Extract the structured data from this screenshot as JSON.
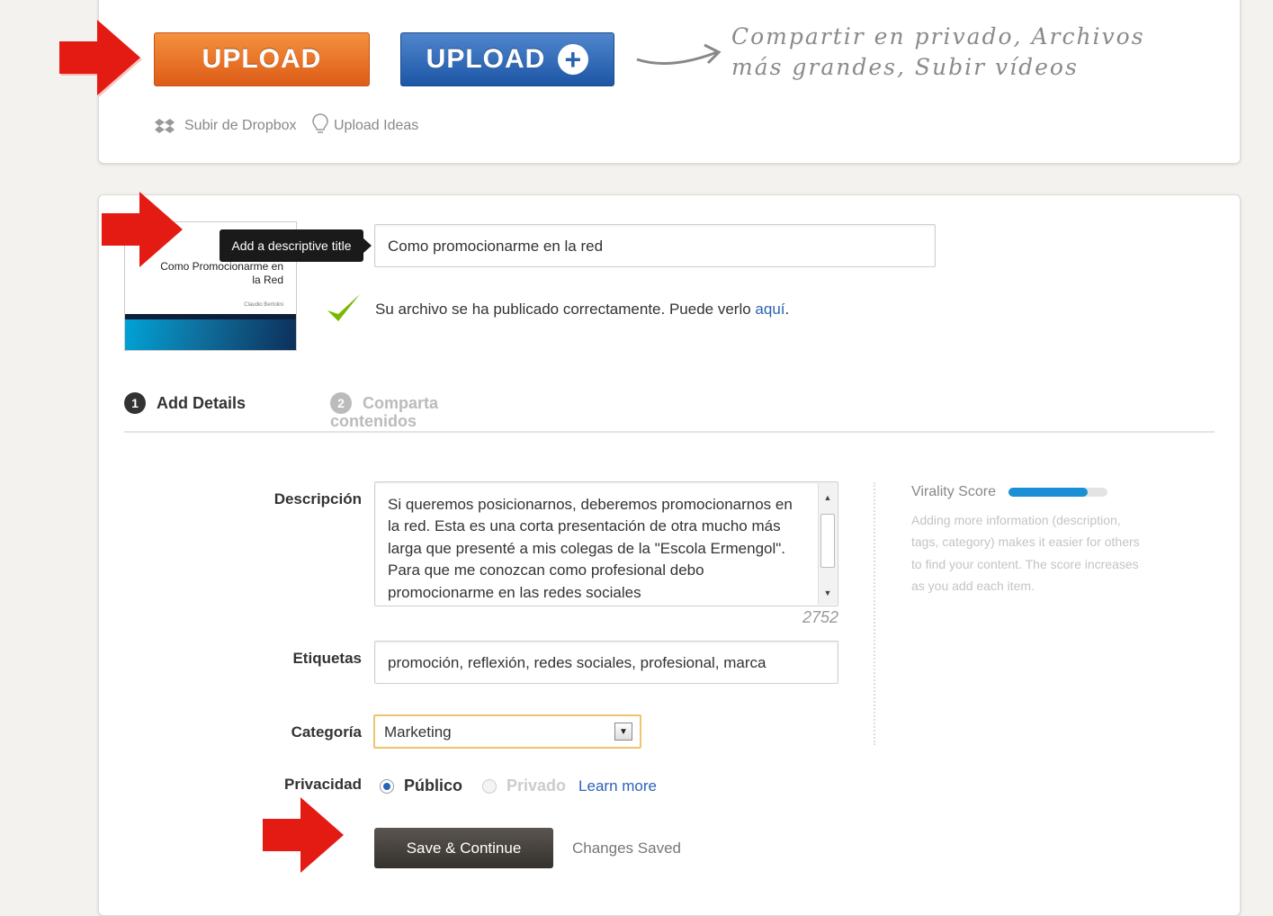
{
  "upload_bar": {
    "upload_label": "UPLOAD",
    "upload_plus_label": "UPLOAD",
    "promo_line1": "Compartir en privado, Archivos",
    "promo_line2": "más grandes, Subir vídeos",
    "dropbox_label": "Subir de Dropbox",
    "ideas_label": "Upload Ideas"
  },
  "document": {
    "thumb_title_line1": "Como Promocionarme en",
    "thumb_title_line2": "la Red",
    "thumb_author": "Claudio Bertolini",
    "tooltip": "Add a descriptive title",
    "title_value": "Como promocionarme en la red",
    "success_text": "Su archivo se ha publicado correctamente. Puede verlo",
    "success_link": "aquí",
    "success_end": "."
  },
  "steps": [
    {
      "num": "1",
      "label": "Add Details"
    },
    {
      "num": "2",
      "label_line1": "Comparta",
      "label_line2": "contenidos"
    }
  ],
  "form": {
    "description_label": "Descripción",
    "description_lines": [
      "Si queremos posicionarnos, deberemos promocionarnos en",
      "la red. Esta es una corta presentación de otra mucho más",
      "larga que presenté a mis colegas de la \"Escola Ermengol\".",
      "Para que me conozcan como profesional debo",
      "promocionarme en las redes sociales"
    ],
    "char_count": "2752",
    "tags_label": "Etiquetas",
    "tags_value": "promoción, reflexión, redes sociales, profesional, marca",
    "category_label": "Categoría",
    "category_value": "Marketing",
    "privacy_label": "Privacidad",
    "privacy_public": "Público",
    "privacy_private": "Privado",
    "learn_more": "Learn more",
    "save_button": "Save & Continue",
    "saved_status": "Changes Saved"
  },
  "virality": {
    "label": "Virality Score",
    "score_fraction": 0.8,
    "help": "Adding more information (description, tags, category) makes it easier for others to find your content. The score increases as you add each item."
  },
  "colors": {
    "upload_orange": "#e8701f",
    "upload_blue": "#2d64b0",
    "arrow_red": "#e31b12",
    "link_blue": "#2a63b5",
    "check_green": "#7ab800",
    "score_bar": "#1a8fd6"
  }
}
